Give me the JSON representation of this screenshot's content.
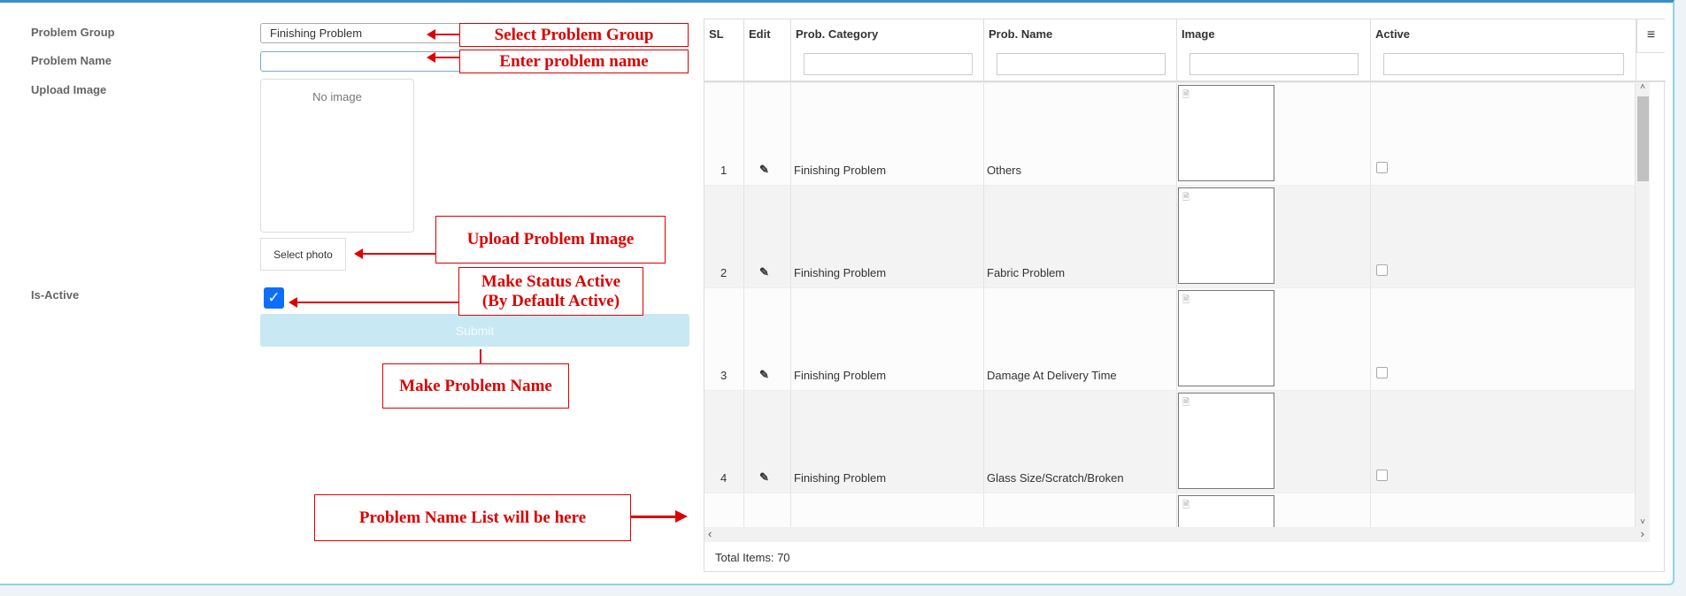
{
  "form": {
    "problem_group_label": "Problem Group",
    "problem_group_value": "Finishing Problem",
    "problem_name_label": "Problem Name",
    "problem_name_value": "",
    "upload_image_label": "Upload Image",
    "no_image_text": "No image",
    "select_photo_label": "Select photo",
    "is_active_label": "Is-Active",
    "is_active_checked": true,
    "submit_label": "Submit"
  },
  "annotations": {
    "select_group": "Select Problem Group",
    "enter_name": "Enter problem name",
    "upload_image": "Upload Problem Image",
    "make_active_1": "Make Status Active",
    "make_active_2": "(By Default Active)",
    "make_name": "Make Problem Name",
    "list_here": "Problem Name List will be here"
  },
  "grid": {
    "columns": [
      "SL",
      "Edit",
      "Prob. Category",
      "Prob. Name",
      "Image",
      "Active"
    ],
    "rows": [
      {
        "sl": "1",
        "category": "Finishing Problem",
        "name": "Others",
        "active": false
      },
      {
        "sl": "2",
        "category": "Finishing Problem",
        "name": "Fabric Problem",
        "active": false
      },
      {
        "sl": "3",
        "category": "Finishing Problem",
        "name": "Damage At Delivery Time",
        "active": false
      },
      {
        "sl": "4",
        "category": "Finishing Problem",
        "name": "Glass Size/Scratch/Broken",
        "active": false
      }
    ],
    "footer": "Total Items: 70"
  },
  "colors": {
    "annotation": "#dd0000",
    "checkbox": "#0d6efd",
    "submit_bg": "#c8e8f3"
  }
}
